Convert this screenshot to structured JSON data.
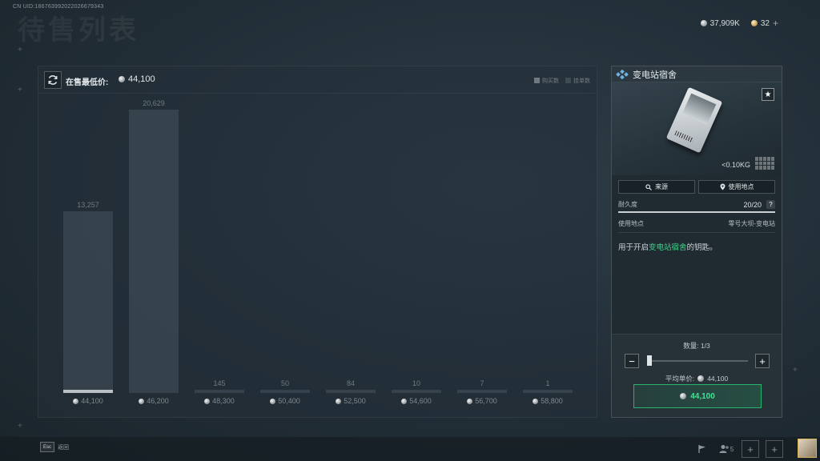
{
  "uid": "CN UID:186763992022026679343",
  "page_title": "待售列表",
  "currency": {
    "balance": "37,909K",
    "premium": "32",
    "add": "+"
  },
  "chart_panel": {
    "min_price_label": "在售最低价:",
    "min_price_value": "44,100",
    "legend": [
      {
        "label": "购买数",
        "color": "#6f7a80"
      },
      {
        "label": "挂单数",
        "color": "#3f4b53"
      }
    ]
  },
  "chart_data": {
    "type": "bar",
    "categories": [
      "44,100",
      "46,200",
      "48,300",
      "50,400",
      "52,500",
      "54,600",
      "56,700",
      "58,800"
    ],
    "values": [
      13257,
      20629,
      145,
      50,
      84,
      10,
      7,
      1
    ],
    "value_labels": [
      "13,257",
      "20,629",
      "145",
      "50",
      "84",
      "10",
      "7",
      "1"
    ],
    "highlighted_index": 0,
    "xlabel": "",
    "ylabel": "",
    "ylim": [
      0,
      21000
    ]
  },
  "item": {
    "name": "变电站宿舍",
    "weight": "<0.10KG",
    "source_label": "来源",
    "use_location_btn": "使用地点",
    "durability_label": "耐久度",
    "durability_value": "20/20",
    "durability_fraction": 1.0,
    "help": "?",
    "use_location_label": "使用地点",
    "use_location_value": "零号大坝-变电站",
    "desc_prefix": "用于开启",
    "desc_highlight": "变电站宿舍",
    "desc_suffix": "的钥匙。",
    "favorite_icon": "★"
  },
  "purchase": {
    "quantity_label": "数量: 1/3",
    "quantity_fraction": 0.0,
    "minus": "−",
    "plus": "+",
    "avg_price_label": "平均单价:",
    "avg_price_value": "44,100",
    "buy_price": "44,100"
  },
  "bottom": {
    "esc_key": "Esc",
    "esc_label": "返回",
    "team_count": "5",
    "add1": "+",
    "add2": "+"
  }
}
